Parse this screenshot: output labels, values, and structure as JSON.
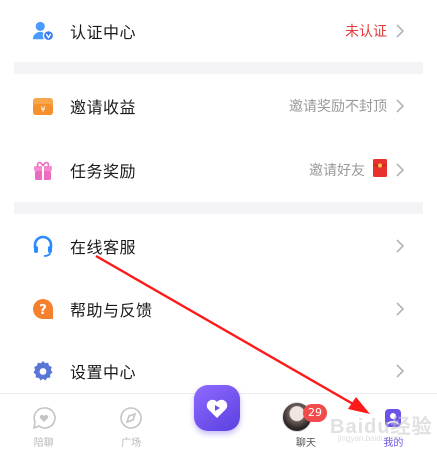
{
  "menu_section_1": {
    "verify": {
      "label": "认证中心",
      "status": "未认证",
      "icon": "user-verify-icon"
    }
  },
  "menu_section_2": {
    "invite_income": {
      "label": "邀请收益",
      "hint": "邀请奖励不封顶",
      "icon": "wallet-icon"
    },
    "task_reward": {
      "label": "任务奖励",
      "hint": "邀请好友",
      "icon": "gift-icon",
      "extra_icon": "red-envelope-icon"
    }
  },
  "menu_section_3": {
    "support": {
      "label": "在线客服",
      "icon": "headset-icon"
    },
    "help": {
      "label": "帮助与反馈",
      "icon": "help-icon"
    },
    "settings": {
      "label": "设置中心",
      "icon": "gear-icon"
    }
  },
  "tabbar": {
    "tabs": [
      {
        "label": "陪聊",
        "icon": "heart-chat-icon",
        "active": false
      },
      {
        "label": "广场",
        "icon": "compass-icon",
        "active": false
      },
      {
        "label": "",
        "icon": "heart-play-icon",
        "active": false
      },
      {
        "label": "聊天",
        "icon": "avatar-icon",
        "active": false
      },
      {
        "label": "我的",
        "icon": "profile-icon",
        "active": true
      }
    ],
    "chat_badge": "29"
  },
  "watermark": {
    "text": "Baidu经验",
    "sub": "jingyan.baidu.com"
  },
  "colors": {
    "accent_red": "#e23b3b",
    "brand_purple": "#6b53e8",
    "badge_red": "#f24b4b"
  }
}
